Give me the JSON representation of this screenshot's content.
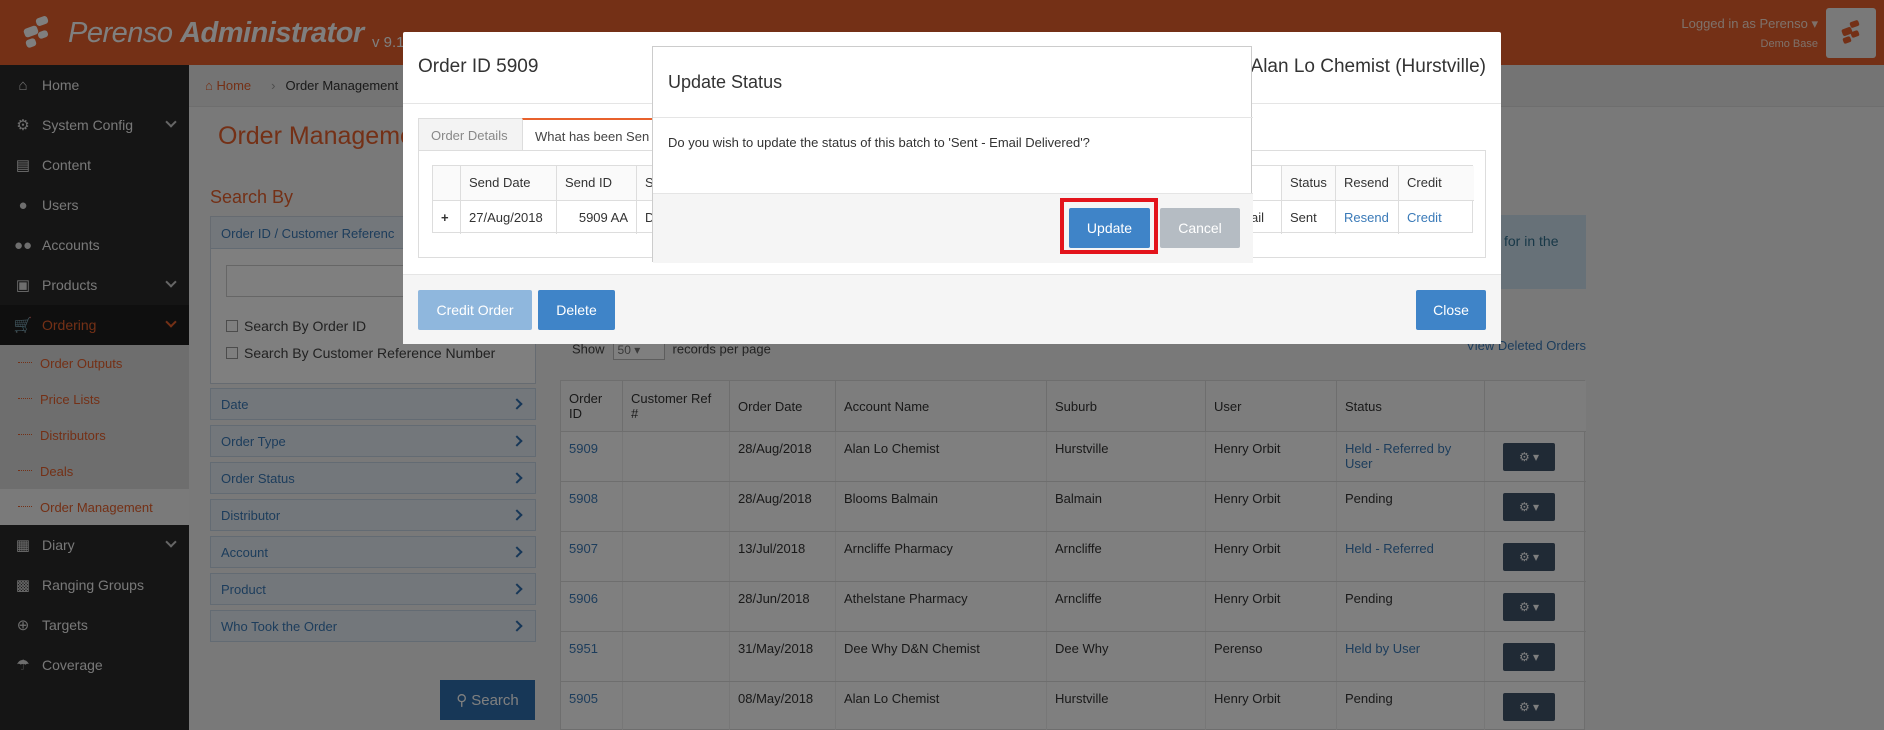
{
  "app": {
    "brand": "Perenso",
    "brand_bold": "Administrator",
    "version": "v 9.1"
  },
  "login": {
    "text": "Logged in as Perenso ▾",
    "sub": "Demo Base"
  },
  "sidebar": {
    "items": [
      {
        "label": "Home",
        "icon": "home-icon"
      },
      {
        "label": "System Config",
        "icon": "gear-icon"
      },
      {
        "label": "Content",
        "icon": "file-icon"
      },
      {
        "label": "Users",
        "icon": "user-icon"
      },
      {
        "label": "Accounts",
        "icon": "users-icon"
      },
      {
        "label": "Products",
        "icon": "gift-icon"
      },
      {
        "label": "Ordering",
        "icon": "cart-icon"
      },
      {
        "label": "Diary",
        "icon": "calendar-icon"
      },
      {
        "label": "Ranging Groups",
        "icon": "cubes-icon"
      },
      {
        "label": "Targets",
        "icon": "crosshairs-icon"
      },
      {
        "label": "Coverage",
        "icon": "umbrella-icon"
      }
    ],
    "subitems": [
      "Order Outputs",
      "Price Lists",
      "Distributors",
      "Deals",
      "Order Management"
    ]
  },
  "breadcrumb": {
    "home": "Home",
    "current": "Order Management"
  },
  "page": {
    "title": "Order Manageme",
    "search_by": "Search By"
  },
  "filters": {
    "panel_title": "Order ID / Customer Referenc",
    "check1": "Search By Order ID",
    "check2": "Search By Customer Reference Number",
    "accordion": [
      "Date",
      "Order Type",
      "Order Status",
      "Distributor",
      "Account",
      "Product",
      "Who Took the Order"
    ],
    "search_button": "Search"
  },
  "info": {
    "text": "for in the"
  },
  "records": {
    "show": "Show",
    "value": "50",
    "suffix": "records per page",
    "view_deleted": "View Deleted Orders"
  },
  "grid": {
    "headers": [
      "Order ID",
      "Customer Ref #",
      "Order Date",
      "Account Name",
      "Suburb",
      "User",
      "Status"
    ],
    "rows": [
      {
        "id": "5909",
        "ref": "",
        "date": "28/Aug/2018",
        "account": "Alan Lo Chemist",
        "suburb": "Hurstville",
        "user": "Henry Orbit",
        "status": "Held - Referred by User"
      },
      {
        "id": "5908",
        "ref": "",
        "date": "28/Aug/2018",
        "account": "Blooms Balmain",
        "suburb": "Balmain",
        "user": "Henry Orbit",
        "status": "Pending"
      },
      {
        "id": "5907",
        "ref": "",
        "date": "13/Jul/2018",
        "account": "Arncliffe Pharmacy",
        "suburb": "Arncliffe",
        "user": "Henry Orbit",
        "status": "Held - Referred"
      },
      {
        "id": "5906",
        "ref": "",
        "date": "28/Jun/2018",
        "account": "Athelstane Pharmacy",
        "suburb": "Arncliffe",
        "user": "Henry Orbit",
        "status": "Pending"
      },
      {
        "id": "5951",
        "ref": "",
        "date": "31/May/2018",
        "account": "Dee Why D&N Chemist",
        "suburb": "Dee Why",
        "user": "Perenso",
        "status": "Held by User"
      },
      {
        "id": "5905",
        "ref": "",
        "date": "08/May/2018",
        "account": "Alan Lo Chemist",
        "suburb": "Hurstville",
        "user": "Henry Orbit",
        "status": "Pending"
      }
    ],
    "status_colors": {
      "Pending": "#333333",
      "link": "#3a7ab8"
    }
  },
  "order_modal": {
    "title": "Order ID 5909",
    "customer": "Alan Lo Chemist (Hurstville)",
    "tabs": [
      "Order Details",
      "What has been Sen"
    ],
    "table_headers_left": [
      "",
      "Send Date",
      "Send ID",
      "S"
    ],
    "table_headers_right": [
      "Status",
      "Resend",
      "Credit"
    ],
    "row": {
      "expand": "+",
      "send_date": "27/Aug/2018",
      "send_id": "5909 AA",
      "s": "D",
      "partial": "ail",
      "status": "Sent",
      "resend": "Resend",
      "credit": "Credit"
    },
    "buttons": {
      "credit": "Credit Order",
      "delete": "Delete",
      "close": "Close"
    }
  },
  "status_modal": {
    "title": "Update Status",
    "message": "Do you wish to update the status of this batch to 'Sent - Email Delivered'?",
    "buttons": {
      "update": "Update",
      "cancel": "Cancel"
    }
  },
  "colors": {
    "brand": "#e8612c",
    "primary": "#3a7ab8",
    "highlight": "#e3141c"
  }
}
